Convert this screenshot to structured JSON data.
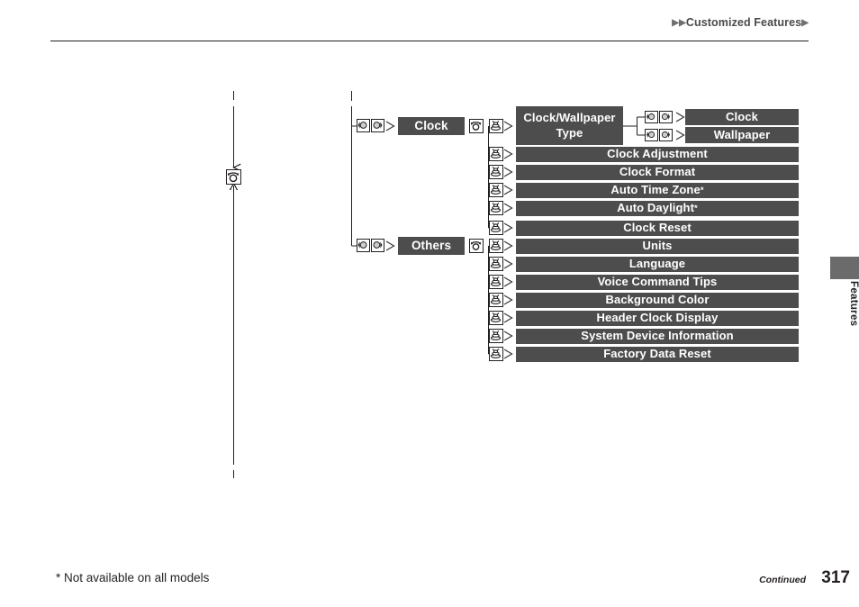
{
  "header": {
    "breadcrumb_prefix": "▶▶",
    "breadcrumb": "Customized Features",
    "breadcrumb_suffix": "▶"
  },
  "side_tab": {
    "label": "Features"
  },
  "footer": {
    "footnote": "* Not available on all models",
    "continued": "Continued",
    "page_number": "317"
  },
  "colors": {
    "box_fill": "#4d4d4d",
    "box_text": "#ffffff",
    "line": "#231f20",
    "tab_fill": "#6b6b6b",
    "page_bg": "#ffffff"
  },
  "diagram": {
    "type": "menu-tree",
    "entry_icons": [
      "dial-left-icon",
      "dial-right-icon"
    ],
    "branches": [
      {
        "name": "clock-branch",
        "label": "Clock",
        "enter_icons": [
          "rotary-knob-icon",
          "press-enter-icon"
        ],
        "items": [
          {
            "label": "Clock/Wallpaper Type",
            "label_lines": [
              "Clock/Wallpaper",
              "Type"
            ],
            "icon": "press-enter-icon",
            "children": [
              {
                "label": "Clock",
                "icons": [
                  "dial-left-icon",
                  "dial-right-icon"
                ]
              },
              {
                "label": "Wallpaper",
                "icons": [
                  "dial-left-icon",
                  "dial-right-icon"
                ]
              }
            ]
          },
          {
            "label": "Clock Adjustment",
            "icon": "press-enter-icon",
            "footnote": false
          },
          {
            "label": "Clock Format",
            "icon": "press-enter-icon",
            "footnote": false
          },
          {
            "label": "Auto Time Zone",
            "icon": "press-enter-icon",
            "footnote": true
          },
          {
            "label": "Auto Daylight",
            "icon": "press-enter-icon",
            "footnote": true
          },
          {
            "label": "Clock Reset",
            "icon": "press-enter-icon",
            "footnote": false
          }
        ]
      },
      {
        "name": "others-branch",
        "label": "Others",
        "enter_icons": [
          "rotary-knob-icon",
          "press-enter-icon"
        ],
        "items": [
          {
            "label": "Units",
            "icon": "press-enter-icon",
            "footnote": false
          },
          {
            "label": "Language",
            "icon": "press-enter-icon",
            "footnote": false
          },
          {
            "label": "Voice Command Tips",
            "icon": "press-enter-icon",
            "footnote": false
          },
          {
            "label": "Background Color",
            "icon": "press-enter-icon",
            "footnote": false
          },
          {
            "label": "Header Clock Display",
            "icon": "press-enter-icon",
            "footnote": false
          },
          {
            "label": "System Device Information",
            "icon": "press-enter-icon",
            "footnote": false
          },
          {
            "label": "Factory Data Reset",
            "icon": "press-enter-icon",
            "footnote": false
          }
        ]
      }
    ],
    "left_flow": {
      "name": "continuation-flow",
      "icon": "rotary-knob-icon",
      "direction_top": "down-arrow",
      "direction_bottom": "up-arrow"
    }
  }
}
